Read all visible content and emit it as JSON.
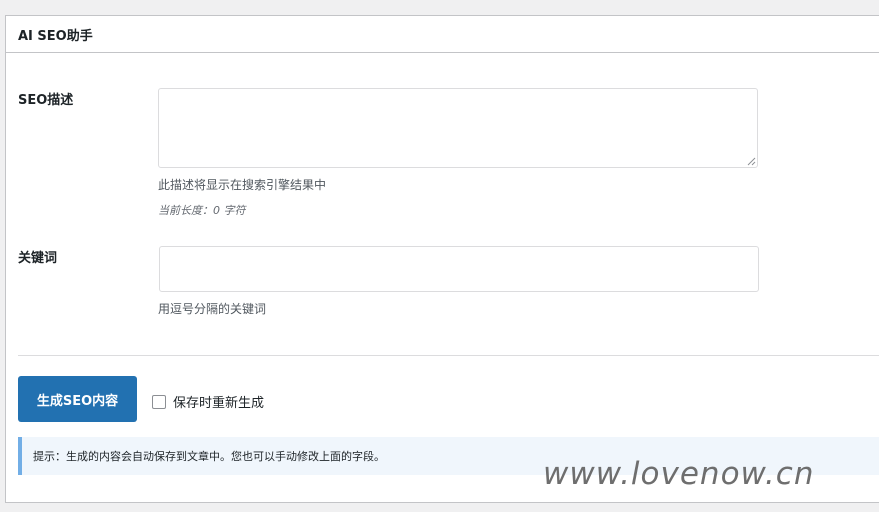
{
  "panel": {
    "title": "AI SEO助手"
  },
  "seo_description": {
    "label": "SEO描述",
    "value": "",
    "help": "此描述将显示在搜索引擎结果中",
    "length_info": "当前长度：0 字符"
  },
  "keywords": {
    "label": "关键词",
    "value": "",
    "help": "用逗号分隔的关键词"
  },
  "actions": {
    "generate_label": "生成SEO内容",
    "regenerate_on_save_label": "保存时重新生成",
    "regenerate_on_save_checked": false
  },
  "notice": {
    "text": "提示：生成的内容会自动保存到文章中。您也可以手动修改上面的字段。"
  },
  "watermark": {
    "text": "www.lovenow.cn"
  },
  "colors": {
    "primary": "#2271b1",
    "notice_bg": "#f0f6fc",
    "notice_border": "#72aee6"
  }
}
